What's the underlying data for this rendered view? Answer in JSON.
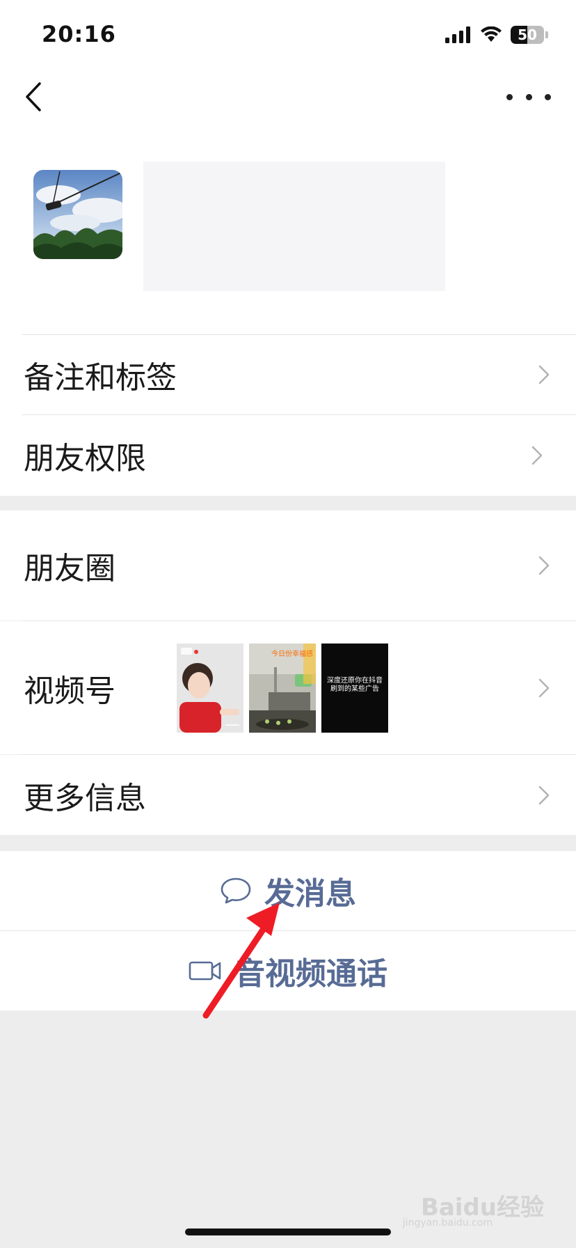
{
  "status_bar": {
    "time": "20:16",
    "battery_level": "50"
  },
  "header": {
    "back_icon": "chevron-left-icon",
    "more_icon": "more-dots-icon"
  },
  "profile": {
    "avatar": "sky-swing-photo"
  },
  "menu": {
    "remarks_tags": "备注和标签",
    "friend_permissions": "朋友权限",
    "moments": "朋友圈",
    "channels": "视频号",
    "more_info": "更多信息"
  },
  "channels_thumbs": {
    "thumb2_title": "今日份幸福感",
    "thumb3_text": "深度还原你在抖音刷到的某些广告"
  },
  "actions": {
    "send_message": "发消息",
    "video_call": "音视频通话"
  },
  "watermark": {
    "brand": "Baidu经验",
    "site": "jingyan.baidu.com"
  },
  "colors": {
    "link": "#576b95",
    "arrow": "#ee1c25",
    "background": "#ededed"
  }
}
